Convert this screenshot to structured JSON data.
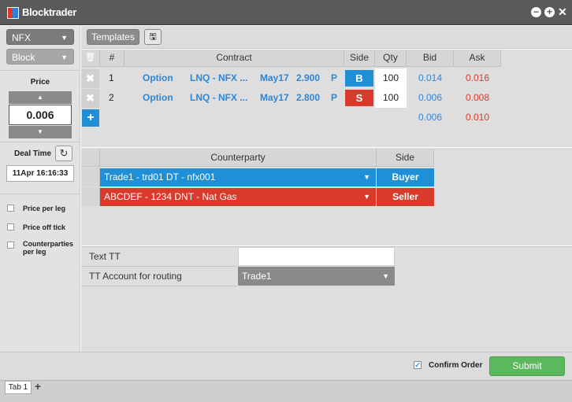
{
  "window": {
    "title": "Blocktrader"
  },
  "left": {
    "market": "NFX",
    "order_type": "Block",
    "price_label": "Price",
    "price_value": "0.006",
    "deal_time_label": "Deal Time",
    "deal_time_value": "11Apr 16:16:33",
    "options": [
      {
        "label": "Price per leg",
        "checked": false
      },
      {
        "label": "Price off tick",
        "checked": false
      },
      {
        "label": "Counterparties per leg",
        "checked": false
      }
    ]
  },
  "toolbar": {
    "templates_label": "Templates"
  },
  "legs": {
    "headers": {
      "num": "#",
      "contract": "Contract",
      "side": "Side",
      "qty": "Qty",
      "bid": "Bid",
      "ask": "Ask"
    },
    "rows": [
      {
        "num": "1",
        "type": "Option",
        "product": "LNQ - NFX ...",
        "expiry": "May17",
        "strike": "2.900",
        "pc": "P",
        "side": "B",
        "qty": "100",
        "bid": "0.014",
        "ask": "0.016"
      },
      {
        "num": "2",
        "type": "Option",
        "product": "LNQ - NFX ...",
        "expiry": "May17",
        "strike": "2.800",
        "pc": "P",
        "side": "S",
        "qty": "100",
        "bid": "0.006",
        "ask": "0.008"
      }
    ],
    "total": {
      "bid": "0.006",
      "ask": "0.010"
    }
  },
  "counterparty": {
    "headers": {
      "counterparty": "Counterparty",
      "side": "Side"
    },
    "rows": [
      {
        "name": "Trade1 - trd01 DT - nfx001",
        "side": "Buyer"
      },
      {
        "name": "ABCDEF - 1234 DNT - Nat Gas",
        "side": "Seller"
      }
    ]
  },
  "tt": {
    "text_label": "Text TT",
    "text_value": "",
    "account_label": "TT Account for routing",
    "account_value": "Trade1"
  },
  "footer": {
    "confirm_label": "Confirm Order",
    "confirm_checked": true,
    "submit_label": "Submit"
  },
  "tabs": [
    {
      "label": "Tab 1"
    }
  ],
  "colors": {
    "buy": "#1f8fd8",
    "sell": "#d93a2b",
    "submit": "#5cb85c",
    "bid_text": "#2e86d4",
    "ask_text": "#d93a2b"
  }
}
